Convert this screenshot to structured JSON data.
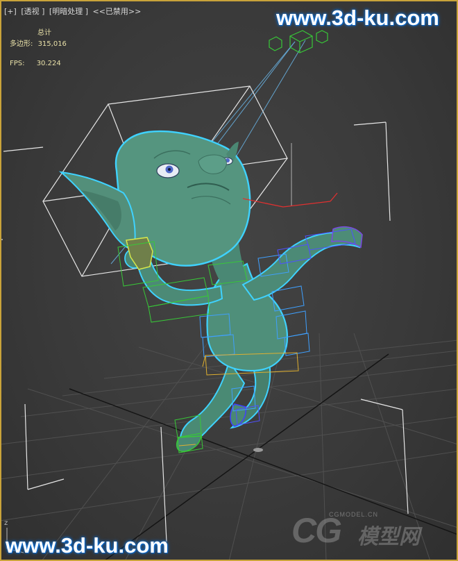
{
  "viewport": {
    "menu": {
      "plus": "[+]",
      "view": "[透视 ]",
      "shading": "[明暗处理 ]",
      "disabled": "<<已禁用>>"
    },
    "stats": {
      "total_label": "总计",
      "polygons_label": "多边形:",
      "polygons_value": "315,016",
      "fps_label": "FPS:",
      "fps_value": "30.224"
    },
    "axis_label": "z"
  },
  "watermarks": {
    "top": "www.3d-ku.com",
    "bottom": "www.3d-ku.com",
    "cg_logo": "CG",
    "cg_domain": "CGMODEL.CN",
    "cg_chinese": "模型网"
  },
  "colors": {
    "viewport_border": "#c9a33a",
    "character_skin": "#4f8f7a",
    "selection_outline": "#3fd2ff",
    "bone_green": "#38c838",
    "bone_blue": "#4040ff",
    "bone_yellow": "#e0b030",
    "helper_white": "#e6e6e6",
    "target_blue": "#6ab6e8",
    "gizmo_red": "#e03030"
  }
}
